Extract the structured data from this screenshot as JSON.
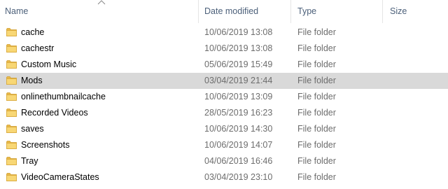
{
  "columns": {
    "name": "Name",
    "date_modified": "Date modified",
    "type": "Type",
    "size": "Size",
    "sort_icon": "chevron-up-icon"
  },
  "colors": {
    "header_text": "#4c607a",
    "selected_row": "#d9d9d9",
    "folder_body": "#e8b94a",
    "folder_front": "#f8d775",
    "secondary_text": "#6d6d6d"
  },
  "files": [
    {
      "name": "cache",
      "date": "10/06/2019 13:08",
      "type": "File folder",
      "size": "",
      "icon": "folder-icon",
      "selected": false
    },
    {
      "name": "cachestr",
      "date": "10/06/2019 13:08",
      "type": "File folder",
      "size": "",
      "icon": "folder-icon",
      "selected": false
    },
    {
      "name": "Custom Music",
      "date": "05/06/2019 15:49",
      "type": "File folder",
      "size": "",
      "icon": "folder-icon",
      "selected": false
    },
    {
      "name": "Mods",
      "date": "03/04/2019 21:44",
      "type": "File folder",
      "size": "",
      "icon": "folder-icon",
      "selected": true
    },
    {
      "name": "onlinethumbnailcache",
      "date": "10/06/2019 13:09",
      "type": "File folder",
      "size": "",
      "icon": "folder-icon",
      "selected": false
    },
    {
      "name": "Recorded Videos",
      "date": "28/05/2019 16:23",
      "type": "File folder",
      "size": "",
      "icon": "folder-icon",
      "selected": false
    },
    {
      "name": "saves",
      "date": "10/06/2019 14:30",
      "type": "File folder",
      "size": "",
      "icon": "folder-icon",
      "selected": false
    },
    {
      "name": "Screenshots",
      "date": "10/06/2019 14:07",
      "type": "File folder",
      "size": "",
      "icon": "folder-icon",
      "selected": false
    },
    {
      "name": "Tray",
      "date": "04/06/2019 16:46",
      "type": "File folder",
      "size": "",
      "icon": "folder-icon",
      "selected": false
    },
    {
      "name": "VideoCameraStates",
      "date": "03/04/2019 23:10",
      "type": "File folder",
      "size": "",
      "icon": "folder-icon",
      "selected": false
    }
  ]
}
